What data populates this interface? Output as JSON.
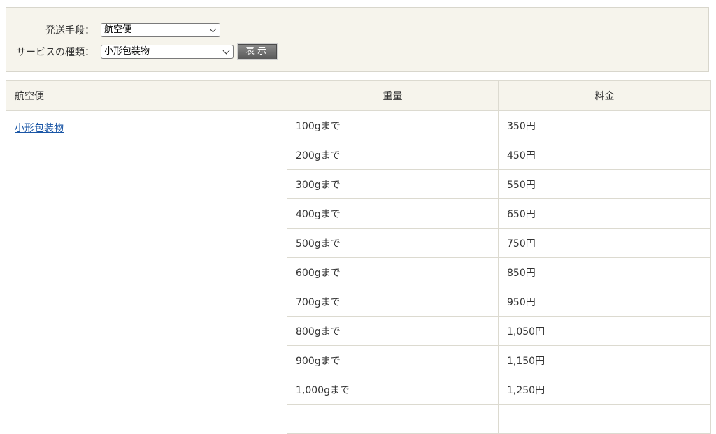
{
  "filters": {
    "method_label": "発送手段：",
    "method_value": "航空便",
    "service_label": "サービスの種類：",
    "service_value": "小形包装物",
    "show_button": "表示"
  },
  "table": {
    "headers": [
      "航空便",
      "重量",
      "料金"
    ],
    "service_link": "小形包装物",
    "rows": [
      {
        "weight": "100gまで",
        "fee": "350円"
      },
      {
        "weight": "200gまで",
        "fee": "450円"
      },
      {
        "weight": "300gまで",
        "fee": "550円"
      },
      {
        "weight": "400gまで",
        "fee": "650円"
      },
      {
        "weight": "500gまで",
        "fee": "750円"
      },
      {
        "weight": "600gまで",
        "fee": "850円"
      },
      {
        "weight": "700gまで",
        "fee": "950円"
      },
      {
        "weight": "800gまで",
        "fee": "1,050円"
      },
      {
        "weight": "900gまで",
        "fee": "1,150円"
      },
      {
        "weight": "1,000gまで",
        "fee": "1,250円"
      },
      {
        "weight": "",
        "fee": ""
      }
    ]
  },
  "colors": {
    "panel_bg": "#f6f4ec",
    "link": "#1a56a6",
    "border": "#dcdad0"
  }
}
